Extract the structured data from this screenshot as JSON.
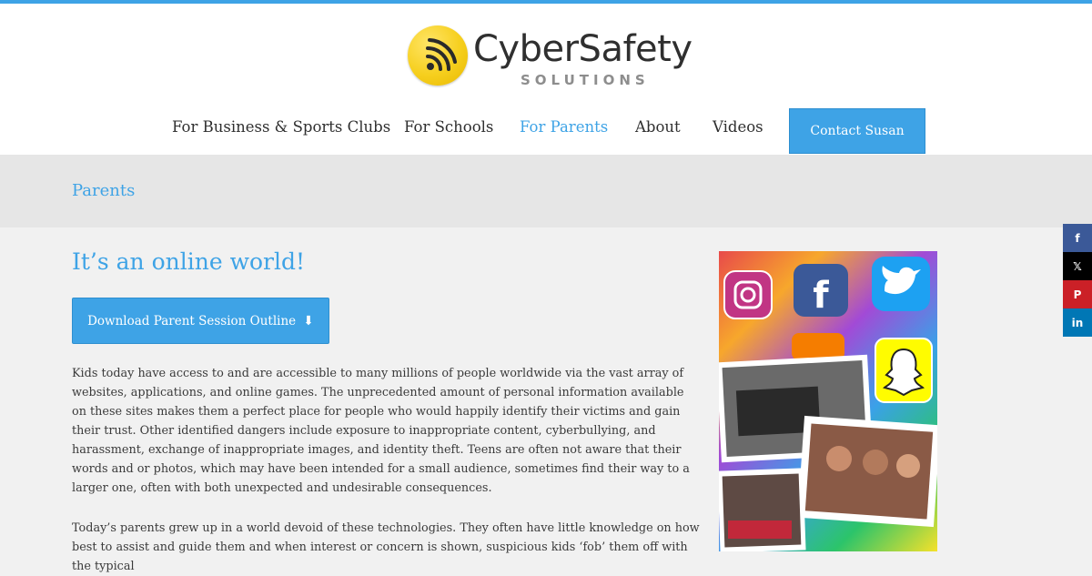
{
  "brand": {
    "name": "CyberSafety",
    "tagline": "SOLUTIONS"
  },
  "nav": {
    "items": [
      {
        "label": "For Business & Sports Clubs",
        "active": false
      },
      {
        "label": "For Schools",
        "active": false
      },
      {
        "label": "For Parents",
        "active": true
      },
      {
        "label": "About",
        "active": false
      },
      {
        "label": "Videos",
        "active": false
      }
    ],
    "contact_label": "Contact Susan"
  },
  "page": {
    "title": "Parents",
    "heading": "It’s an online world!",
    "download_label": "Download Parent Session Outline",
    "paragraphs": [
      "Kids today have access to and are accessible to many millions of people worldwide via the vast array of websites, applications, and online games. The unprecedented amount of personal information available on these sites makes them a perfect place for people who would happily identify their victims and gain their trust. Other identified dangers include exposure to inappropriate content, cyberbullying, and harassment, exchange of inappropriate images, and identity theft. Teens are often not aware that their words and or photos, which may have been intended for a small audience, sometimes find their way to a larger one, often with both unexpected and undesirable consequences.",
      "Today’s parents grew up in a world devoid of these technologies. They often have little knowledge on how best to assist and guide them and when interest or concern is shown, suspicious kids ‘fob’ them off with the typical"
    ]
  },
  "social": [
    {
      "icon": "facebook-icon",
      "glyph": "f",
      "color": "#3b5998"
    },
    {
      "icon": "x-icon",
      "glyph": "𝕏",
      "color": "#000000"
    },
    {
      "icon": "pinterest-icon",
      "glyph": "P",
      "color": "#cb2027"
    },
    {
      "icon": "linkedin-icon",
      "glyph": "in",
      "color": "#0077b5"
    }
  ],
  "colors": {
    "accent": "#3ea3e6",
    "text": "#3a3a3a",
    "logo_yellow": "#f6cf1e"
  }
}
